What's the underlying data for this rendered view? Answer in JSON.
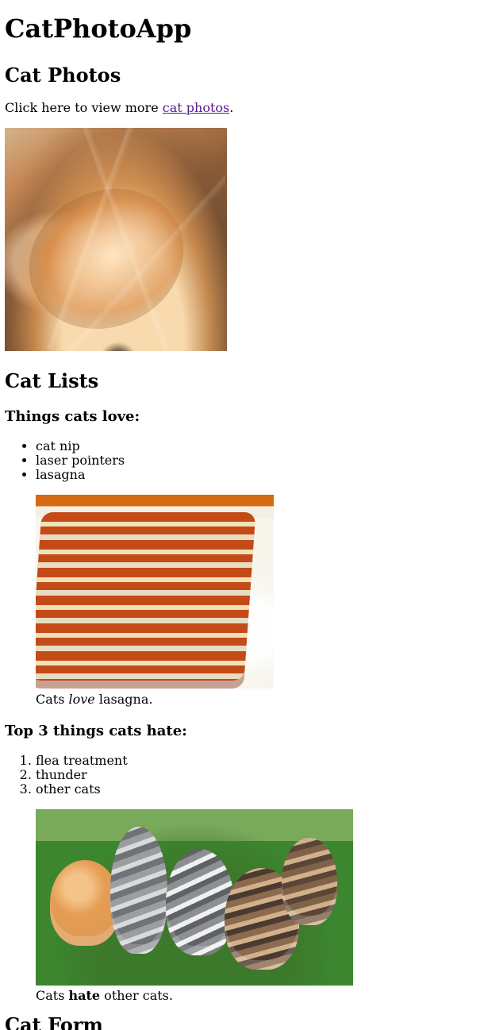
{
  "page": {
    "title": "CatPhotoApp",
    "section_heading": "Cat Photos",
    "intro_prefix": "Click here to view more ",
    "intro_link": "cat photos",
    "intro_suffix": ".",
    "images": {
      "top": "cat-photo",
      "lasagna": "lasagna-photo",
      "kittens": "kittens-photo"
    },
    "lists_heading": "Cat Lists",
    "love_heading": "Things cats love:",
    "love_items": [
      "cat nip",
      "laser pointers",
      "lasagna"
    ],
    "love_caption_prefix": "Cats ",
    "love_caption_emphasis": "love",
    "love_caption_suffix": " lasagna.",
    "hate_heading": "Top 3 things cats hate:",
    "hate_items": [
      "flea treatment",
      "thunder",
      "other cats"
    ],
    "hate_caption_prefix": "Cats ",
    "hate_caption_emphasis": "hate",
    "hate_caption_suffix": " other cats.",
    "form_heading": "Cat Form"
  }
}
